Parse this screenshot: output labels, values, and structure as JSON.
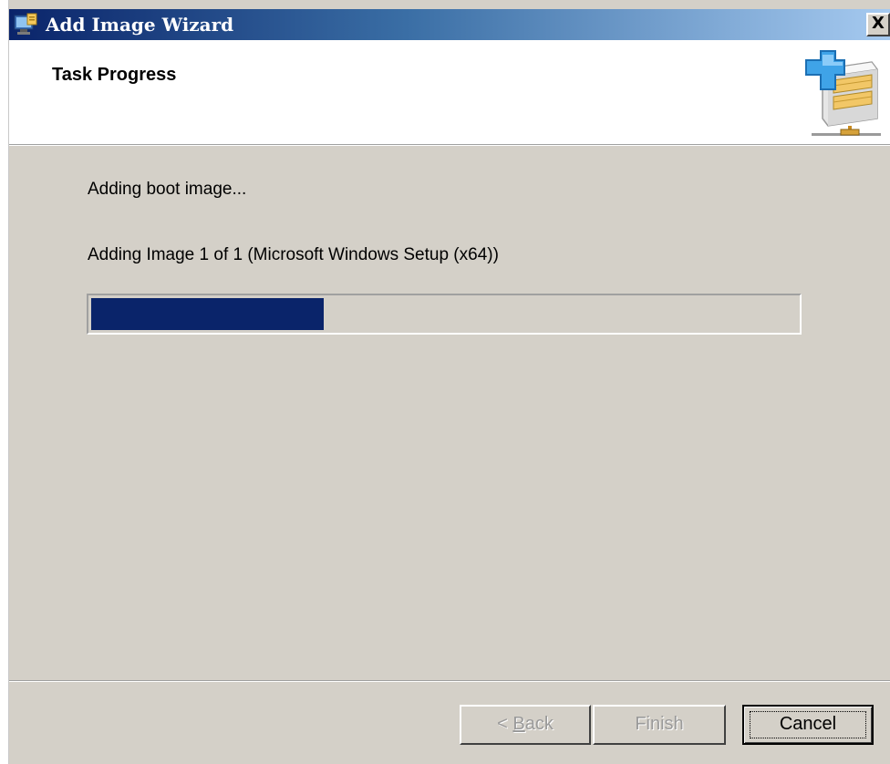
{
  "window": {
    "title": "Add Image Wizard",
    "close_symbol": "X",
    "icon": "wds-wizard-icon"
  },
  "header": {
    "title": "Task Progress",
    "icon": "add-image-server-icon"
  },
  "main": {
    "status": "Adding boot image...",
    "detail": "Adding Image 1 of 1 (Microsoft Windows Setup (x64))",
    "progress_fraction": 0.33
  },
  "buttons": {
    "back_prefix": "< ",
    "back_access": "B",
    "back_rest": "ack",
    "finish": "Finish",
    "cancel": "Cancel"
  },
  "colors": {
    "titlebar_start": "#0a246a",
    "titlebar_end": "#a6caf0",
    "progress": "#0a246a",
    "dialog_bg": "#d4d0c8"
  }
}
